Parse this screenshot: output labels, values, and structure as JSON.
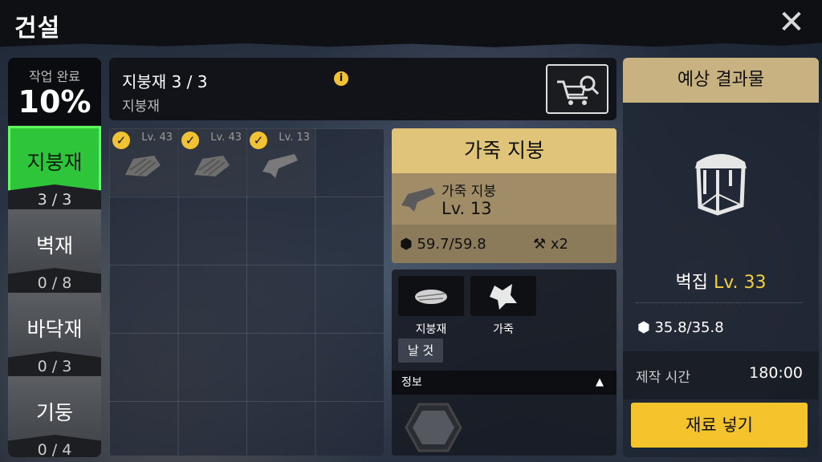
{
  "title": "건설",
  "progress": {
    "label": "작업 완료",
    "value": "10%"
  },
  "categories": [
    {
      "name": "지붕재",
      "count": "3 / 3",
      "active": true
    },
    {
      "name": "벽재",
      "count": "0 / 8"
    },
    {
      "name": "바닥재",
      "count": "0 / 3"
    },
    {
      "name": "기둥",
      "count": "0 / 4"
    }
  ],
  "header": {
    "title": "지붕재 3 / 3",
    "subtitle": "지붕재",
    "info_icon": "i"
  },
  "slots": [
    {
      "lv": "Lv. 43",
      "check": "✓"
    },
    {
      "lv": "Lv. 43",
      "check": "✓"
    },
    {
      "lv": "Lv. 13",
      "check": "✓"
    }
  ],
  "detail": {
    "title": "가죽 지붕",
    "item_name": "가죽 지붕",
    "item_lv": "Lv. 13",
    "durability": "59.7/59.8",
    "multiplier": "x2"
  },
  "materials": [
    {
      "label": "지붕재"
    },
    {
      "label": "가죽"
    }
  ],
  "raw_tag": "날 것",
  "info_label": "정보",
  "result": {
    "header": "예상 결과물",
    "name": "벽집",
    "level": "Lv. 33",
    "durability": "35.8/35.8",
    "time_label": "제작 시간",
    "time_value": "180:00",
    "button": "재료 넣기"
  }
}
